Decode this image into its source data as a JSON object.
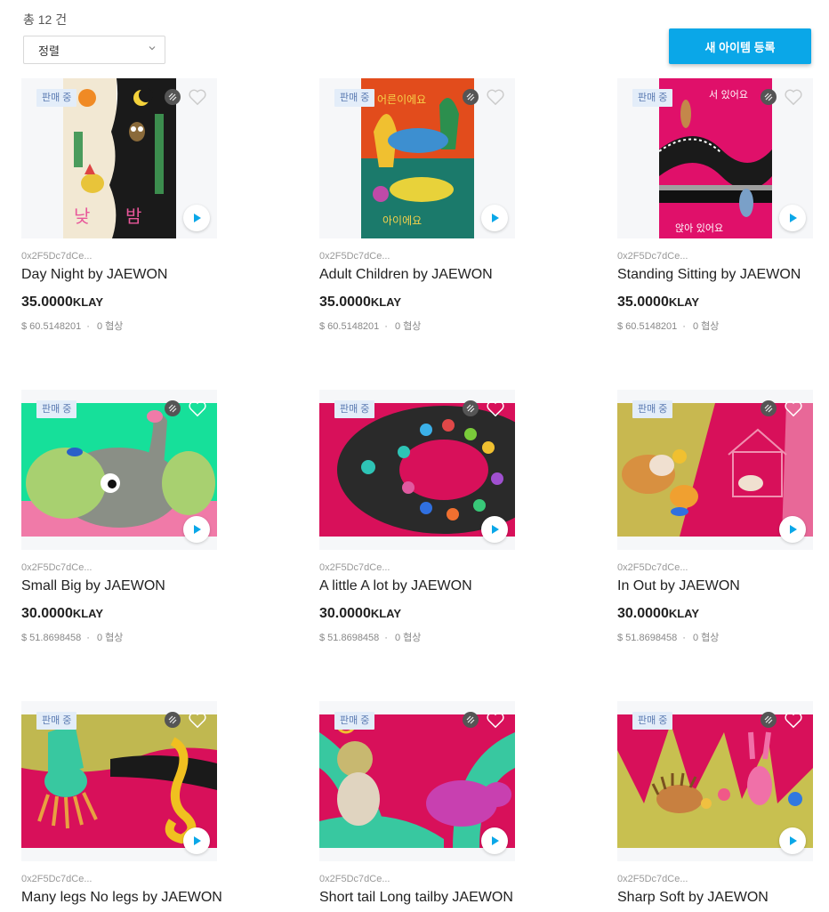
{
  "header": {
    "count_label": "총 12 건",
    "sort_label": "정렬",
    "new_item_label": "새 아이템 등록"
  },
  "colors": {
    "accent": "#0aa7e8",
    "badge_bg": "#e3edf9",
    "badge_text": "#5b7bb2"
  },
  "items": [
    {
      "badge": "판매 중",
      "owner": "0x2F5Dc7dCe...",
      "title": "Day Night by JAEWON",
      "price": "35.0000",
      "unit": "KLAY",
      "usd": "$ 60.5148201",
      "dot": "·",
      "offer": "0 협상",
      "art": "day-night-poster"
    },
    {
      "badge": "판매 중",
      "owner": "0x2F5Dc7dCe...",
      "title": "Adult Children by JAEWON",
      "price": "35.0000",
      "unit": "KLAY",
      "usd": "$ 60.5148201",
      "dot": "·",
      "offer": "0 협상",
      "art": "adult-children-poster"
    },
    {
      "badge": "판매 중",
      "owner": "0x2F5Dc7dCe...",
      "title": "Standing Sitting by JAEWON",
      "price": "35.0000",
      "unit": "KLAY",
      "usd": "$ 60.5148201",
      "dot": "·",
      "offer": "0 협상",
      "art": "standing-sitting-poster"
    },
    {
      "badge": "판매 중",
      "owner": "0x2F5Dc7dCe...",
      "title": "Small Big by JAEWON",
      "price": "30.0000",
      "unit": "KLAY",
      "usd": "$ 51.8698458",
      "dot": "·",
      "offer": "0 협상",
      "art": "small-big-elephant"
    },
    {
      "badge": "판매 중",
      "owner": "0x2F5Dc7dCe...",
      "title": "A little A lot by JAEWON",
      "price": "30.0000",
      "unit": "KLAY",
      "usd": "$ 51.8698458",
      "dot": "·",
      "offer": "0 협상",
      "art": "a-little-a-lot-birds"
    },
    {
      "badge": "판매 중",
      "owner": "0x2F5Dc7dCe...",
      "title": "In Out by JAEWON",
      "price": "30.0000",
      "unit": "KLAY",
      "usd": "$ 51.8698458",
      "dot": "·",
      "offer": "0 협상",
      "art": "in-out-animals"
    },
    {
      "badge": "판매 중",
      "owner": "0x2F5Dc7dCe...",
      "title": "Many legs No legs by JAEWON",
      "price": "",
      "unit": "",
      "usd": "",
      "dot": "",
      "offer": "",
      "art": "many-legs-squid"
    },
    {
      "badge": "판매 중",
      "owner": "0x2F5Dc7dCe...",
      "title": "Short tail Long tailby JAEWON",
      "price": "",
      "unit": "",
      "usd": "",
      "dot": "",
      "offer": "",
      "art": "short-tail-monkey"
    },
    {
      "badge": "판매 중",
      "owner": "0x2F5Dc7dCe...",
      "title": "Sharp Soft by JAEWON",
      "price": "",
      "unit": "",
      "usd": "",
      "dot": "",
      "offer": "",
      "art": "sharp-soft-hedgehog"
    }
  ]
}
